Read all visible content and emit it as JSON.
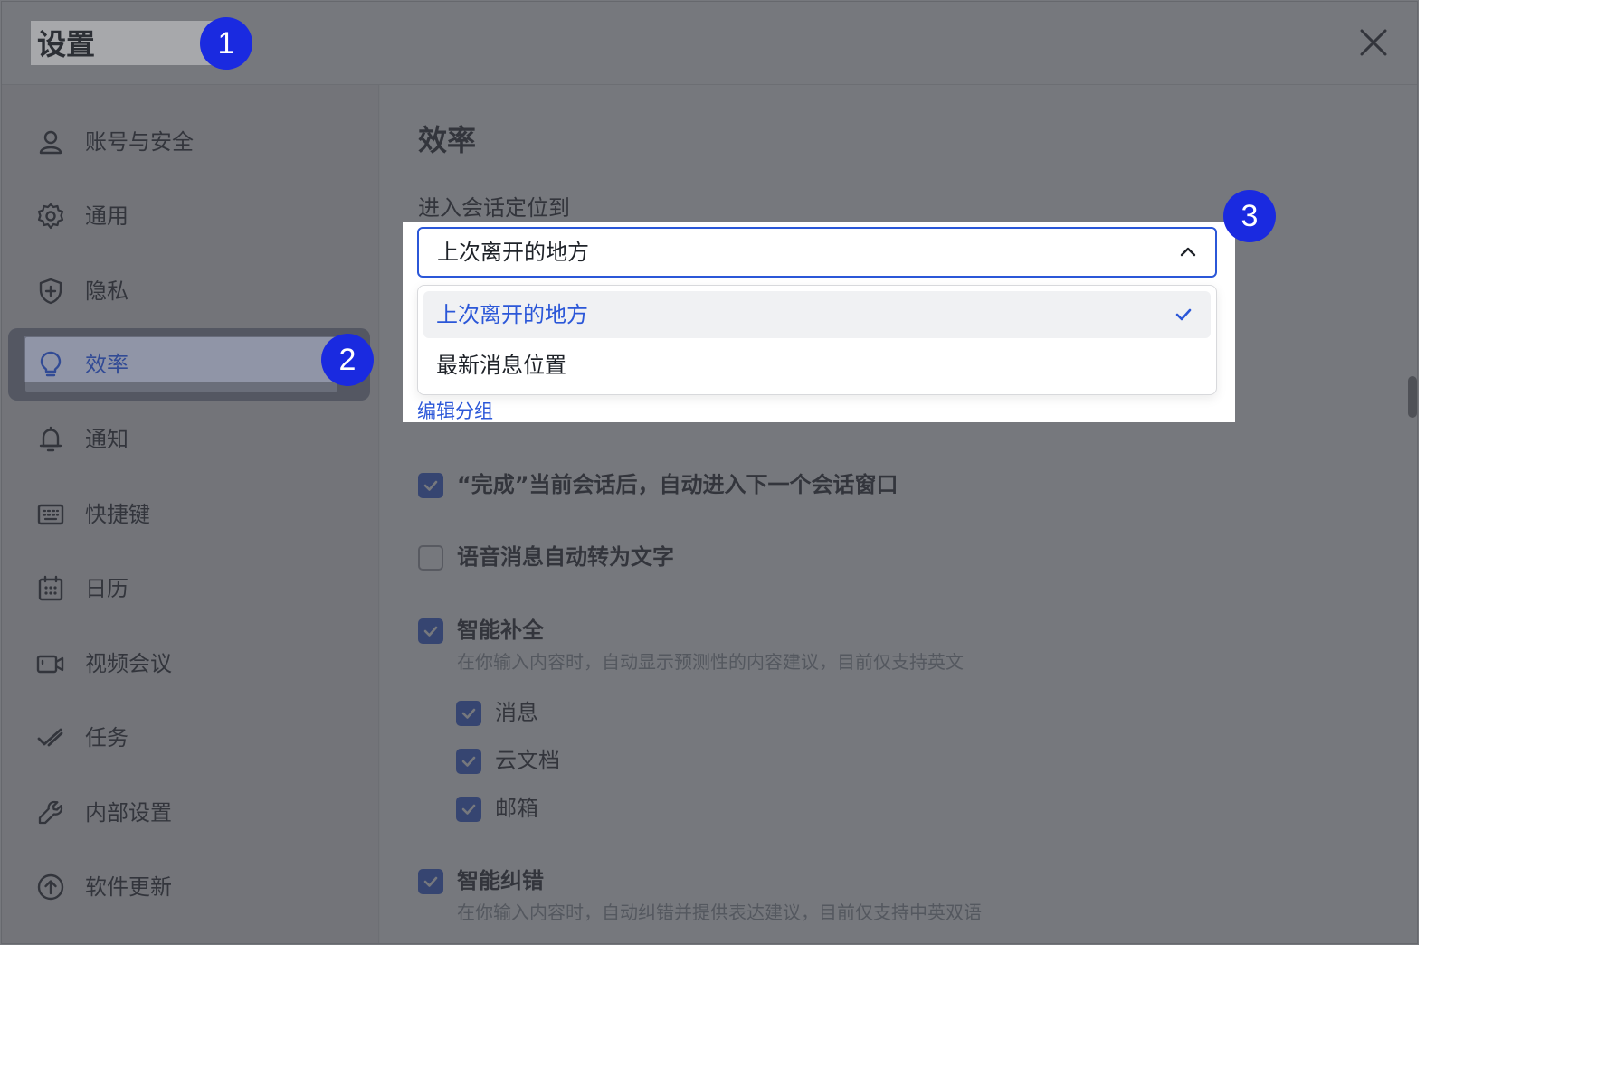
{
  "window": {
    "title": "设置",
    "close_icon": "close-icon"
  },
  "sidebar": {
    "items": [
      {
        "label": "账号与安全",
        "icon": "user-icon"
      },
      {
        "label": "通用",
        "icon": "gear-icon"
      },
      {
        "label": "隐私",
        "icon": "shield-icon"
      },
      {
        "label": "效率",
        "icon": "lightbulb-icon",
        "active": true
      },
      {
        "label": "通知",
        "icon": "bell-icon"
      },
      {
        "label": "快捷键",
        "icon": "keyboard-icon"
      },
      {
        "label": "日历",
        "icon": "calendar-icon"
      },
      {
        "label": "视频会议",
        "icon": "video-icon"
      },
      {
        "label": "任务",
        "icon": "task-icon"
      },
      {
        "label": "内部设置",
        "icon": "wrench-icon"
      },
      {
        "label": "软件更新",
        "icon": "upload-icon"
      }
    ]
  },
  "main": {
    "section_title": "效率",
    "position_field": {
      "label": "进入会话定位到",
      "selected": "上次离开的地方",
      "options": [
        "上次离开的地方",
        "最新消息位置"
      ]
    },
    "edit_groups_link": "编辑分组",
    "options": {
      "auto_next": {
        "label": "“完成”当前会话后，自动进入下一个会话窗口",
        "checked": true
      },
      "voice_to_text": {
        "label": "语音消息自动转为文字",
        "checked": false
      },
      "smart_complete": {
        "label": "智能补全",
        "checked": true,
        "description": "在你输入内容时，自动显示预测性的内容建议，目前仅支持英文",
        "sub": [
          {
            "label": "消息",
            "checked": true
          },
          {
            "label": "云文档",
            "checked": true
          },
          {
            "label": "邮箱",
            "checked": true
          }
        ]
      },
      "smart_correct": {
        "label": "智能纠错",
        "checked": true,
        "description": "在你输入内容时，自动纠错并提供表达建议，目前仅支持中英双语"
      }
    }
  },
  "annotations": [
    "1",
    "2",
    "3"
  ],
  "colors": {
    "accent": "#2b57d8",
    "badge": "#1a2ae0",
    "active_nav_bg": "#d6ddf8"
  }
}
